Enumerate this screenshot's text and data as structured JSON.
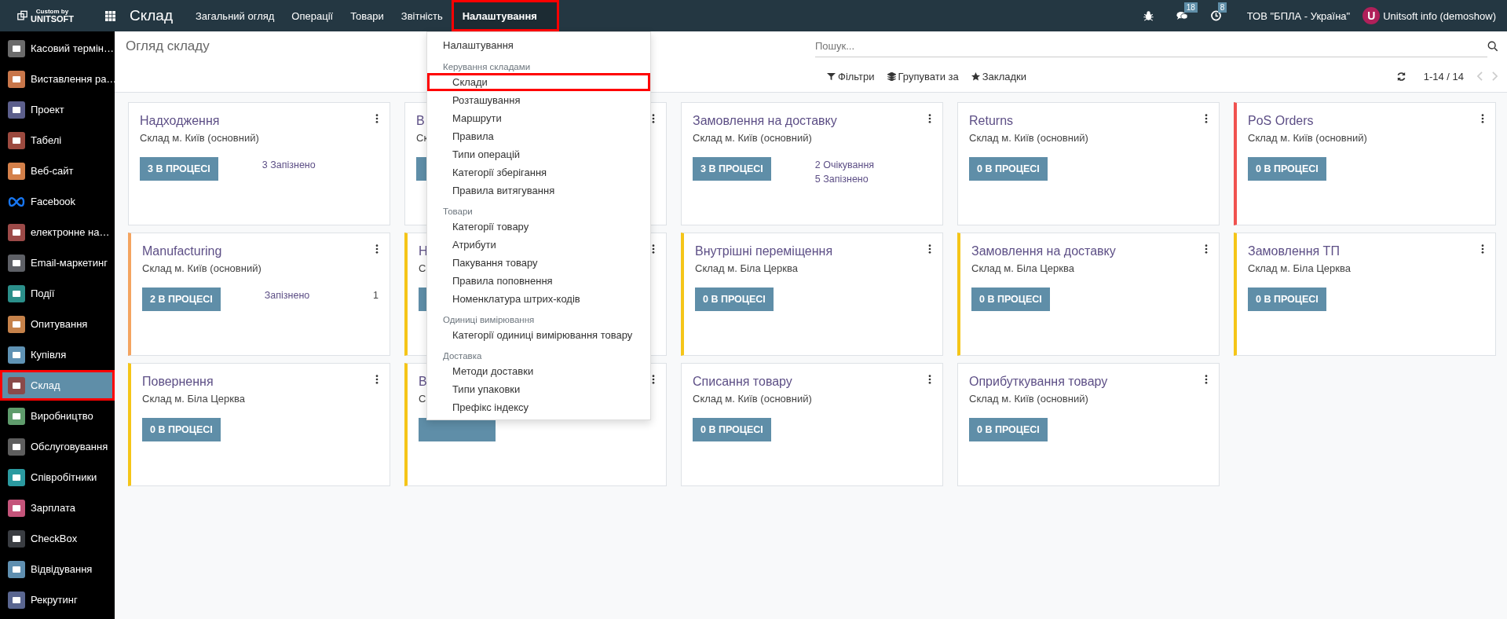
{
  "topbar": {
    "logo_small": "Custom by",
    "logo_big": "UNITSOFT",
    "app_name": "Склад",
    "menus": [
      {
        "label": "Загальний огляд",
        "selected": false,
        "highlighted": false
      },
      {
        "label": "Операції",
        "selected": false,
        "highlighted": false
      },
      {
        "label": "Товари",
        "selected": false,
        "highlighted": false
      },
      {
        "label": "Звітність",
        "selected": false,
        "highlighted": false
      },
      {
        "label": "Налаштування",
        "selected": true,
        "highlighted": true
      }
    ],
    "messages_count": "18",
    "activities_count": "8",
    "company": "ТОВ \"БПЛА - Україна\"",
    "avatar_letter": "U",
    "user": "Unitsoft info (demoshow)"
  },
  "sidebar": {
    "items": [
      {
        "label": "Касовий термін…",
        "kind": "tile",
        "color": "#6b6b6b",
        "selected": false,
        "highlighted": false
      },
      {
        "label": "Виставлення ра…",
        "kind": "tile",
        "color": "#c8764a",
        "selected": false,
        "highlighted": false
      },
      {
        "label": "Проект",
        "kind": "tile",
        "color": "#5c5f8c",
        "selected": false,
        "highlighted": false
      },
      {
        "label": "Табелі",
        "kind": "tile",
        "color": "#9c4a3f",
        "selected": false,
        "highlighted": false
      },
      {
        "label": "Веб-сайт",
        "kind": "tile",
        "color": "#d4804a",
        "selected": false,
        "highlighted": false
      },
      {
        "label": "Facebook",
        "kind": "logo",
        "color": "#1877f2",
        "selected": false,
        "highlighted": false
      },
      {
        "label": "електронне на…",
        "kind": "tile",
        "color": "#9c4a48",
        "selected": false,
        "highlighted": false
      },
      {
        "label": "Email-маркетинг",
        "kind": "tile",
        "color": "#5e6066",
        "selected": false,
        "highlighted": false
      },
      {
        "label": "Події",
        "kind": "tile",
        "color": "#2b8f8a",
        "selected": false,
        "highlighted": false
      },
      {
        "label": "Опитування",
        "kind": "tile",
        "color": "#c6824a",
        "selected": false,
        "highlighted": false
      },
      {
        "label": "Купівля",
        "kind": "tile",
        "color": "#5f92b4",
        "selected": false,
        "highlighted": false
      },
      {
        "label": "Склад",
        "kind": "tile",
        "color": "#8a4a4a",
        "selected": true,
        "highlighted": true
      },
      {
        "label": "Виробництво",
        "kind": "tile",
        "color": "#5f9c6c",
        "selected": false,
        "highlighted": false
      },
      {
        "label": "Обслуговування",
        "kind": "tile",
        "color": "#5e5e5e",
        "selected": false,
        "highlighted": false
      },
      {
        "label": "Співробітники",
        "kind": "tile",
        "color": "#2b9aa0",
        "selected": false,
        "highlighted": false
      },
      {
        "label": "Зарплата",
        "kind": "tile",
        "color": "#c4547a",
        "selected": false,
        "highlighted": false
      },
      {
        "label": "CheckBox",
        "kind": "tile",
        "color": "#3a3d42",
        "selected": false,
        "highlighted": false
      },
      {
        "label": "Відвідування",
        "kind": "tile",
        "color": "#5f8fb0",
        "selected": false,
        "highlighted": false
      },
      {
        "label": "Рекрутинг",
        "kind": "tile",
        "color": "#5a6690",
        "selected": false,
        "highlighted": false
      }
    ]
  },
  "control_panel": {
    "title": "Огляд складу",
    "search": {
      "placeholder": "Пошук..."
    },
    "filters": "Фільтри",
    "group_by": "Групувати за",
    "favorites": "Закладки",
    "pager": "1-14 / 14"
  },
  "dropdown": {
    "items": [
      {
        "kind": "item",
        "label": "Налаштування",
        "highlighted": false
      },
      {
        "kind": "header",
        "label": "Керування складами",
        "highlighted": false
      },
      {
        "kind": "subitem",
        "label": "Склади",
        "highlighted": true
      },
      {
        "kind": "subitem",
        "label": "Розташування",
        "highlighted": false
      },
      {
        "kind": "subitem",
        "label": "Маршрути",
        "highlighted": false
      },
      {
        "kind": "subitem",
        "label": "Правила",
        "highlighted": false
      },
      {
        "kind": "subitem",
        "label": "Типи операцій",
        "highlighted": false
      },
      {
        "kind": "subitem",
        "label": "Категорії зберігання",
        "highlighted": false
      },
      {
        "kind": "subitem",
        "label": "Правила витягування",
        "highlighted": false
      },
      {
        "kind": "header",
        "label": "Товари",
        "highlighted": false
      },
      {
        "kind": "subitem",
        "label": "Категорії товару",
        "highlighted": false
      },
      {
        "kind": "subitem",
        "label": "Атрибути",
        "highlighted": false
      },
      {
        "kind": "subitem",
        "label": "Пакування товару",
        "highlighted": false
      },
      {
        "kind": "subitem",
        "label": "Правила поповнення",
        "highlighted": false
      },
      {
        "kind": "subitem",
        "label": "Номенклатура штрих-кодів",
        "highlighted": false
      },
      {
        "kind": "header",
        "label": "Одиниці вимірювання",
        "highlighted": false
      },
      {
        "kind": "subitem",
        "label": "Категорії одиниці вимірювання товару",
        "highlighted": false
      },
      {
        "kind": "header",
        "label": "Доставка",
        "highlighted": false
      },
      {
        "kind": "subitem",
        "label": "Методи доставки",
        "highlighted": false
      },
      {
        "kind": "subitem",
        "label": "Типи упаковки",
        "highlighted": false
      },
      {
        "kind": "subitem",
        "label": "Префікс індексу",
        "highlighted": false
      }
    ]
  },
  "cards": [
    {
      "title": "Надходження",
      "warehouse": "Склад м. Київ (основний)",
      "button": "3 В ПРОЦЕСІ",
      "stats": [
        {
          "label": "3 Запізнено"
        }
      ]
    },
    {
      "title": "В",
      "warehouse": "Ск"
    },
    {
      "title": "Замовлення на доставку",
      "warehouse": "Склад м. Київ (основний)",
      "button": "3 В ПРОЦЕСІ",
      "stats": [
        {
          "label": "2 Очікування"
        },
        {
          "label": "5 Запізнено"
        }
      ]
    },
    {
      "title": "Returns",
      "warehouse": "Склад м. Київ (основний)",
      "button": "0 В ПРОЦЕСІ"
    },
    {
      "title": "PoS Orders",
      "warehouse": "Склад м. Київ (основний)",
      "button": "0 В ПРОЦЕСІ",
      "color": "#f0524f"
    },
    {
      "title": "Manufacturing",
      "warehouse": "Склад м. Київ (основний)",
      "button": "2 В ПРОЦЕСІ",
      "color": "#f4a460",
      "stats": [
        {
          "label": "Запізнено",
          "count": "1"
        }
      ]
    },
    {
      "title": "Н",
      "warehouse": "С",
      "color": "#f5c518"
    },
    {
      "title": "Внутрішні переміщення",
      "warehouse": "Склад м. Біла Церква",
      "button": "0 В ПРОЦЕСІ",
      "color": "#f5c518"
    },
    {
      "title": "Замовлення на доставку",
      "warehouse": "Склад м. Біла Церква",
      "button": "0 В ПРОЦЕСІ",
      "color": "#f5c518"
    },
    {
      "title": "Замовлення ТП",
      "warehouse": "Склад м. Біла Церква",
      "button": "0 В ПРОЦЕСІ",
      "color": "#f5c518"
    },
    {
      "title": "Повернення",
      "warehouse": "Склад м. Біла Церква",
      "button": "0 В ПРОЦЕСІ",
      "color": "#f5c518"
    },
    {
      "title": "В",
      "warehouse": "С",
      "color": "#f5c518"
    },
    {
      "title": "Списання товару",
      "warehouse": "Склад м. Київ (основний)",
      "button": "0 В ПРОЦЕСІ"
    },
    {
      "title": "Оприбуткування товару",
      "warehouse": "Склад м. Київ (основний)",
      "button": "0 В ПРОЦЕСІ"
    }
  ]
}
